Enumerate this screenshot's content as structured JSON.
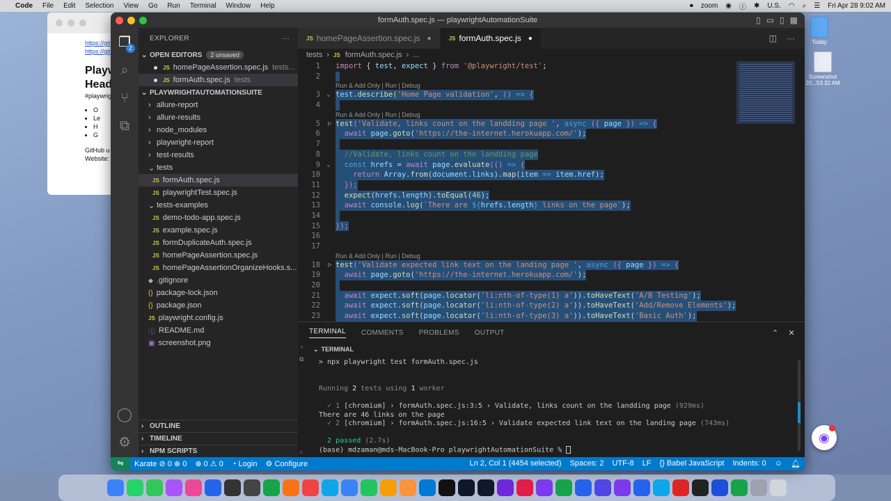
{
  "menubar": {
    "app": "Code",
    "items": [
      "File",
      "Edit",
      "Selection",
      "View",
      "Go",
      "Run",
      "Terminal",
      "Window",
      "Help"
    ],
    "zoom": "zoom",
    "input": "U.S.",
    "clock": "Fri Apr 28  9:02 AM"
  },
  "desktop": {
    "today": "Today",
    "screenshot_label": "Screenshot 20...53.32 AM"
  },
  "bg_window": {
    "link1": "https://git",
    "link2": "https://git",
    "heading": "Playw Head",
    "tag": "#playwrig",
    "bullets": [
      "O",
      "Le",
      "H",
      "G"
    ],
    "footer1": "GitHub u",
    "footer2": "Website:"
  },
  "window": {
    "title": "formAuth.spec.js — playwrightAutomationSuite"
  },
  "explorer": {
    "title": "EXPLORER",
    "open_editors": "OPEN EDITORS",
    "unsaved": "2 unsaved",
    "open_files": [
      {
        "name": "homePageAssertion.spec.js",
        "dir": "tests..."
      },
      {
        "name": "formAuth.spec.js",
        "dir": "tests"
      }
    ],
    "project": "PLAYWRIGHTAUTOMATIONSUITE",
    "tree": [
      {
        "type": "folder",
        "name": "allure-report",
        "open": false,
        "indent": 1
      },
      {
        "type": "folder",
        "name": "allure-results",
        "open": false,
        "indent": 1
      },
      {
        "type": "folder",
        "name": "node_modules",
        "open": false,
        "indent": 1
      },
      {
        "type": "folder",
        "name": "playwright-report",
        "open": false,
        "indent": 1
      },
      {
        "type": "folder",
        "name": "test-results",
        "open": false,
        "indent": 1
      },
      {
        "type": "folder",
        "name": "tests",
        "open": true,
        "indent": 1
      },
      {
        "type": "js",
        "name": "formAuth.spec.js",
        "indent": 2,
        "selected": true
      },
      {
        "type": "js",
        "name": "playwrightTest.spec.js",
        "indent": 2
      },
      {
        "type": "folder",
        "name": "tests-examples",
        "open": true,
        "indent": 1
      },
      {
        "type": "js",
        "name": "demo-todo-app.spec.js",
        "indent": 2
      },
      {
        "type": "js",
        "name": "example.spec.js",
        "indent": 2
      },
      {
        "type": "js",
        "name": "formDuplicateAuth.spec.js",
        "indent": 2
      },
      {
        "type": "js",
        "name": "homePageAssertion.spec.js",
        "indent": 2
      },
      {
        "type": "js",
        "name": "homePageAssertionOrganizeHooks.s...",
        "indent": 2
      },
      {
        "type": "git",
        "name": ".gitignore",
        "indent": 1
      },
      {
        "type": "json",
        "name": "package-lock.json",
        "indent": 1
      },
      {
        "type": "json",
        "name": "package.json",
        "indent": 1
      },
      {
        "type": "js",
        "name": "playwright.config.js",
        "indent": 1
      },
      {
        "type": "info",
        "name": "README.md",
        "indent": 1
      },
      {
        "type": "img",
        "name": "screenshot.png",
        "indent": 1
      }
    ],
    "outline": "OUTLINE",
    "timeline": "TIMELINE",
    "npm": "NPM SCRIPTS"
  },
  "tabs": [
    {
      "label": "homePageAssertion.spec.js",
      "active": false,
      "mark": "●"
    },
    {
      "label": "formAuth.spec.js",
      "active": true,
      "mark": "●"
    }
  ],
  "breadcrumb": {
    "folder": "tests",
    "file": "formAuth.spec.js",
    "more": "..."
  },
  "codelens": "Run & Add Only | Run | Debug",
  "code": [
    {
      "n": 1,
      "html": "<span class='kw'>import</span><span class='pn'> { </span><span class='vr'>test</span><span class='pn'>, </span><span class='vr'>expect</span><span class='pn'> } </span><span class='kw'>from</span><span class='pn'> </span><span class='st'>'@playwright/test'</span><span class='pn'>;</span>",
      "hl": false
    },
    {
      "n": 2,
      "html": "",
      "hl": true
    },
    {
      "lens": true
    },
    {
      "n": 3,
      "html": "<span class='vr'>test</span><span class='pn'>.</span><span class='fn'>describe</span><span class='yl'>(</span><span class='st'>'Home Page validation'</span><span class='pn'>, </span><span class='kw'>()</span><span class='bl'> =&gt; </span><span class='kw'>{</span>",
      "hl": true,
      "fold": true
    },
    {
      "n": 4,
      "html": "",
      "hl": true
    },
    {
      "lens": true
    },
    {
      "n": 5,
      "html": "<span class='fn'>test</span><span class='kw'>(</span><span class='st'>'Validate, links count on the landding page '</span><span class='pn'>, </span><span class='bl'>async</span><span class='pn'> </span><span class='kw'>({</span><span class='pn'> </span><span class='vr'>page</span><span class='pn'> </span><span class='kw'>})</span><span class='bl'> =&gt; </span><span class='kw'>{</span>",
      "hl": true,
      "fold": true,
      "run": true
    },
    {
      "n": 6,
      "html": "  <span class='kw'>await</span><span class='pn'> </span><span class='vr'>page</span><span class='pn'>.</span><span class='fn'>goto</span><span class='pn'>(</span><span class='st'>'https://the-internet.herokuapp.com/'</span><span class='pn'>);</span>",
      "hl": true
    },
    {
      "n": 7,
      "html": "",
      "hl": true
    },
    {
      "n": 8,
      "html": "  <span class='cm'>//Validate, links count on the landding page</span>",
      "hl": true
    },
    {
      "n": 9,
      "html": "  <span class='bl'>const</span><span class='pn'> </span><span class='vr'>hrefs</span><span class='pn'> = </span><span class='kw'>await</span><span class='pn'> </span><span class='vr'>page</span><span class='pn'>.</span><span class='fn'>evaluate</span><span class='kw'>(()</span><span class='bl'> =&gt; </span><span class='kw'>{</span>",
      "hl": true,
      "fold": true
    },
    {
      "n": 10,
      "html": "    <span class='kw'>return</span><span class='pn'> </span><span class='vr'>Array</span><span class='pn'>.</span><span class='fn'>from</span><span class='pn'>(</span><span class='vr'>document</span><span class='pn'>.</span><span class='vr'>links</span><span class='pn'>).</span><span class='fn'>map</span><span class='pn'>(</span><span class='vr'>item</span><span class='bl'> =&gt; </span><span class='vr'>item</span><span class='pn'>.</span><span class='vr'>href</span><span class='pn'>);</span>",
      "hl": true
    },
    {
      "n": 11,
      "html": "  <span class='kw'>});</span>",
      "hl": true
    },
    {
      "n": 12,
      "html": "  <span class='fn'>expect</span><span class='pn'>(</span><span class='vr'>hrefs</span><span class='pn'>.</span><span class='vr'>length</span><span class='pn'>).</span><span class='fn'>toEqual</span><span class='pn'>(</span><span class='nm'>46</span><span class='pn'>);</span>",
      "hl": true
    },
    {
      "n": 13,
      "html": "  <span class='kw'>await</span><span class='pn'> </span><span class='vr'>console</span><span class='pn'>.</span><span class='fn'>log</span><span class='pn'>(</span><span class='st'>`There are </span><span class='bl'>${</span><span class='vr'>hrefs</span><span class='pn'>.</span><span class='vr'>length</span><span class='bl'>}</span><span class='st'> links on the page`</span><span class='pn'>);</span>",
      "hl": true
    },
    {
      "n": 14,
      "html": "",
      "hl": true
    },
    {
      "n": 15,
      "html": "<span class='kw'>});</span>",
      "hl": true
    },
    {
      "n": 16,
      "html": "",
      "hl": false
    },
    {
      "n": 17,
      "html": "",
      "hl": false
    },
    {
      "lens": true
    },
    {
      "n": 18,
      "html": "<span class='fn'>test</span><span class='kw'>(</span><span class='st'>'Validate expected link text on the landing page '</span><span class='pn'>, </span><span class='bl'>async</span><span class='pn'> </span><span class='kw'>({</span><span class='pn'> </span><span class='vr'>page</span><span class='pn'> </span><span class='kw'>})</span><span class='bl'> =&gt; </span><span class='kw'>{</span>",
      "hl": true,
      "fold": true,
      "run": true
    },
    {
      "n": 19,
      "html": "  <span class='kw'>await</span><span class='pn'> </span><span class='vr'>page</span><span class='pn'>.</span><span class='fn'>goto</span><span class='pn'>(</span><span class='st'>'https://the-internet.herokuapp.com/'</span><span class='pn'>);</span>",
      "hl": true
    },
    {
      "n": 20,
      "html": "",
      "hl": true
    },
    {
      "n": 21,
      "html": "  <span class='kw'>await</span><span class='pn'> </span><span class='vr'>expect</span><span class='pn'>.</span><span class='fn'>soft</span><span class='pn'>(</span><span class='vr'>page</span><span class='pn'>.</span><span class='fn'>locator</span><span class='pn'>(</span><span class='st'>'li:nth-of-type(1) a'</span><span class='pn'>)).</span><span class='fn'>toHaveText</span><span class='pn'>(</span><span class='st'>'A/B Testing'</span><span class='pn'>);</span>",
      "hl": true
    },
    {
      "n": 22,
      "html": "  <span class='kw'>await</span><span class='pn'> </span><span class='vr'>expect</span><span class='pn'>.</span><span class='fn'>soft</span><span class='pn'>(</span><span class='vr'>page</span><span class='pn'>.</span><span class='fn'>locator</span><span class='pn'>(</span><span class='st'>'li:nth-of-type(2) a'</span><span class='pn'>)).</span><span class='fn'>toHaveText</span><span class='pn'>(</span><span class='st'>'Add/Remove Elements'</span><span class='pn'>);</span>",
      "hl": true
    },
    {
      "n": 23,
      "html": "  <span class='kw'>await</span><span class='pn'> </span><span class='vr'>expect</span><span class='pn'>.</span><span class='fn'>soft</span><span class='pn'>(</span><span class='vr'>page</span><span class='pn'>.</span><span class='fn'>locator</span><span class='pn'>(</span><span class='st'>'li:nth-of-type(3) a'</span><span class='pn'>)).</span><span class='fn'>toHaveText</span><span class='pn'>(</span><span class='st'>'Basic Auth'</span><span class='pn'>);</span>",
      "hl": true
    }
  ],
  "panel": {
    "tabs": [
      "TERMINAL",
      "COMMENTS",
      "PROBLEMS",
      "OUTPUT"
    ],
    "terminal_header": "TERMINAL",
    "command": "> npx playwright test formAuth.spec.js",
    "running": [
      "Running ",
      "2",
      " tests using ",
      "1",
      " worker"
    ],
    "result1": {
      "check": "✓",
      "num": "1",
      "text": "[chromium] › formAuth.spec.js:3:5 › Validate, links count on the landding page",
      "time": "(929ms)"
    },
    "log": "There are 46 links on the page",
    "result2": {
      "check": "✓",
      "num": "2",
      "text": "[chromium] › formAuth.spec.js:16:5 › Validate expected link text on the landing page",
      "time": "(743ms)"
    },
    "passed": "2 passed",
    "passed_time": "(2.7s)",
    "prompt": "(base) mdzaman@mds-MacBook-Pro playwrightAutomationSuite % "
  },
  "statusbar": {
    "karate": "Karate",
    "karate_counts": "⊘ 0 ⊗ 0",
    "problems": "⊗ 0 ⚠ 0",
    "login": "Login",
    "configure": "Configure",
    "position": "Ln 2, Col 1 (4454 selected)",
    "spaces": "Spaces: 2",
    "encoding": "UTF-8",
    "eol": "LF",
    "language": "Babel JavaScript",
    "indents": "Indents: 0"
  },
  "colors": {
    "accent": "#007acc",
    "selection": "#264f78",
    "remote": "#16825d"
  }
}
